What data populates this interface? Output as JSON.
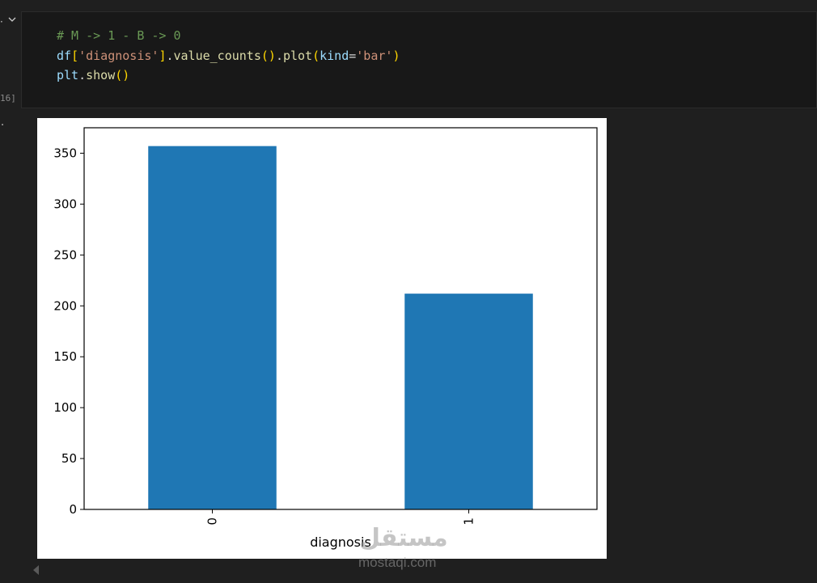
{
  "cell": {
    "execution_count": "16]",
    "code_lines": [
      [
        {
          "t": "# M -> 1 - B -> 0",
          "c": "tok-comment"
        }
      ],
      [
        {
          "t": "df",
          "c": "tok-var"
        },
        {
          "t": "[",
          "c": "tok-br1"
        },
        {
          "t": "'diagnosis'",
          "c": "tok-str"
        },
        {
          "t": "]",
          "c": "tok-br1"
        },
        {
          "t": ".",
          "c": "tok-plain"
        },
        {
          "t": "value_counts",
          "c": "tok-fn"
        },
        {
          "t": "()",
          "c": "tok-br1"
        },
        {
          "t": ".",
          "c": "tok-plain"
        },
        {
          "t": "plot",
          "c": "tok-fn"
        },
        {
          "t": "(",
          "c": "tok-br1"
        },
        {
          "t": "kind",
          "c": "tok-var"
        },
        {
          "t": "=",
          "c": "tok-plain"
        },
        {
          "t": "'bar'",
          "c": "tok-str"
        },
        {
          "t": ")",
          "c": "tok-br1"
        }
      ],
      [
        {
          "t": "plt",
          "c": "tok-var"
        },
        {
          "t": ".",
          "c": "tok-plain"
        },
        {
          "t": "show",
          "c": "tok-fn"
        },
        {
          "t": "()",
          "c": "tok-br1"
        }
      ]
    ]
  },
  "icons": {
    "collapse": "chevron-down-icon",
    "scroll": "scroll-left-arrow-icon"
  },
  "chart_data": {
    "type": "bar",
    "categories": [
      "0",
      "1"
    ],
    "values": [
      357,
      212
    ],
    "xlabel": "diagnosis",
    "ylabel": "",
    "ylim": [
      0,
      375
    ],
    "yticks": [
      0,
      50,
      100,
      150,
      200,
      250,
      300,
      350
    ],
    "bar_color": "#1f77b4",
    "xtick_rotation": "vertical",
    "grid": false
  },
  "watermark": {
    "logo": "مستقل",
    "text": "mostaqi.com"
  }
}
